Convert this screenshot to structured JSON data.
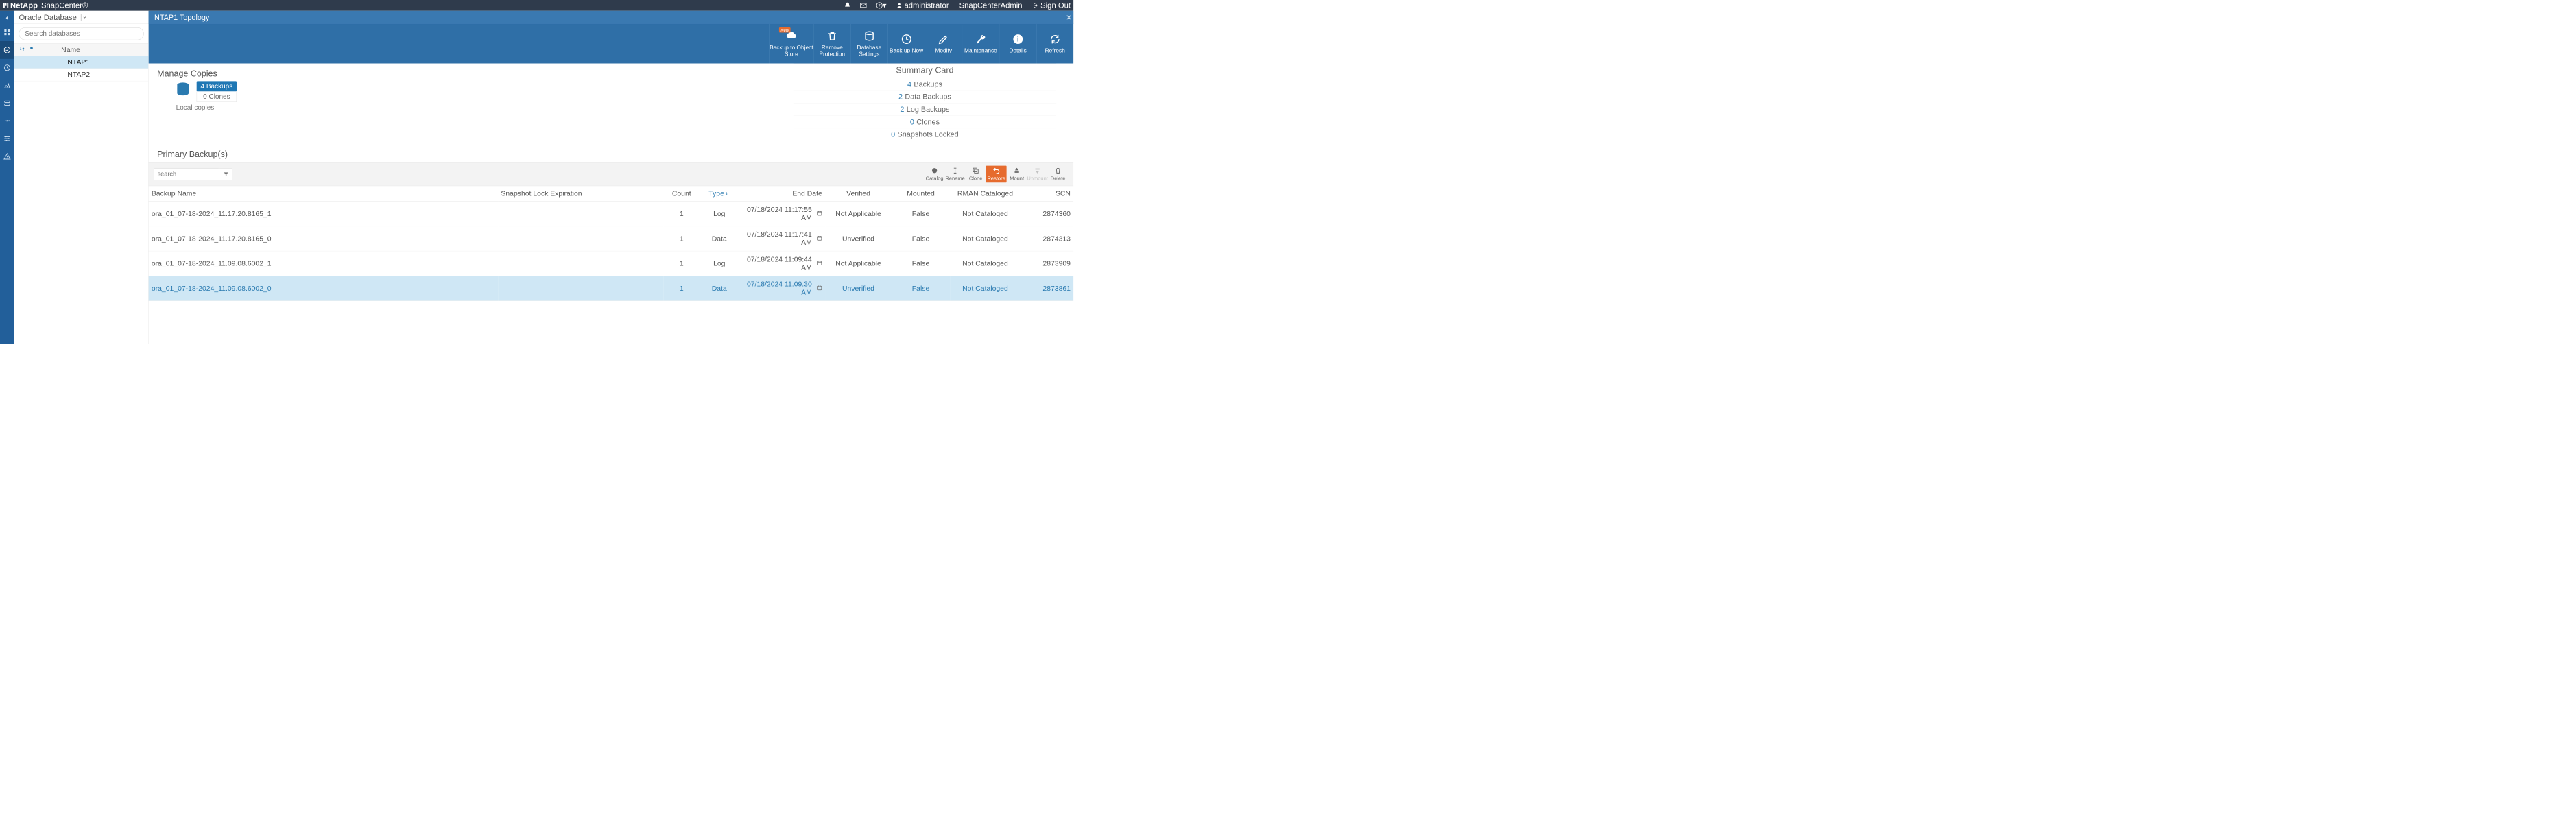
{
  "topbar": {
    "brand_company": "NetApp",
    "brand_product": "SnapCenter®",
    "user_name": "administrator",
    "role_name": "SnapCenterAdmin",
    "signout": "Sign Out"
  },
  "subhead": {
    "resource_type": "Oracle Database"
  },
  "search": {
    "placeholder": "Search databases"
  },
  "rescol": {
    "name_header": "Name"
  },
  "dbs": [
    {
      "name": "NTAP1",
      "selected": true
    },
    {
      "name": "NTAP2",
      "selected": false
    }
  ],
  "crumb": {
    "text": "NTAP1 Topology"
  },
  "blue_actions": {
    "backup_obj": "Backup to Object Store",
    "remove_protection": "Remove Protection",
    "database_settings": "Database Settings",
    "back_up_now": "Back up Now",
    "modify": "Modify",
    "maintenance": "Maintenance",
    "details": "Details",
    "refresh": "Refresh",
    "new_badge": "New"
  },
  "manage": {
    "title": "Manage Copies",
    "backups_pill": "4 Backups",
    "clones_pill": "0 Clones",
    "local_label": "Local copies"
  },
  "summary": {
    "title": "Summary Card",
    "rows": [
      {
        "n": "4",
        "t": "Backups"
      },
      {
        "n": "2",
        "t": "Data Backups"
      },
      {
        "n": "2",
        "t": "Log Backups"
      },
      {
        "n": "0",
        "t": "Clones"
      },
      {
        "n": "0",
        "t": "Snapshots Locked"
      }
    ]
  },
  "pb": {
    "title": "Primary Backup(s)",
    "search_placeholder": "search",
    "actions": {
      "catalog": "Catalog",
      "rename": "Rename",
      "clone": "Clone",
      "restore": "Restore",
      "mount": "Mount",
      "unmount": "Unmount",
      "delete": "Delete"
    },
    "headers": {
      "name": "Backup Name",
      "sle": "Snapshot Lock Expiration",
      "count": "Count",
      "type": "Type",
      "end": "End Date",
      "verified": "Verified",
      "mounted": "Mounted",
      "rman": "RMAN Cataloged",
      "scn": "SCN"
    },
    "rows": [
      {
        "name": "ora_01_07-18-2024_11.17.20.8165_1",
        "sle": "",
        "count": "1",
        "type": "Log",
        "end": "07/18/2024 11:17:55 AM",
        "verified": "Not Applicable",
        "mounted": "False",
        "rman": "Not Cataloged",
        "scn": "2874360",
        "selected": false
      },
      {
        "name": "ora_01_07-18-2024_11.17.20.8165_0",
        "sle": "",
        "count": "1",
        "type": "Data",
        "end": "07/18/2024 11:17:41 AM",
        "verified": "Unverified",
        "mounted": "False",
        "rman": "Not Cataloged",
        "scn": "2874313",
        "selected": false
      },
      {
        "name": "ora_01_07-18-2024_11.09.08.6002_1",
        "sle": "",
        "count": "1",
        "type": "Log",
        "end": "07/18/2024 11:09:44 AM",
        "verified": "Not Applicable",
        "mounted": "False",
        "rman": "Not Cataloged",
        "scn": "2873909",
        "selected": false
      },
      {
        "name": "ora_01_07-18-2024_11.09.08.6002_0",
        "sle": "",
        "count": "1",
        "type": "Data",
        "end": "07/18/2024 11:09:30 AM",
        "verified": "Unverified",
        "mounted": "False",
        "rman": "Not Cataloged",
        "scn": "2873861",
        "selected": true
      }
    ]
  }
}
